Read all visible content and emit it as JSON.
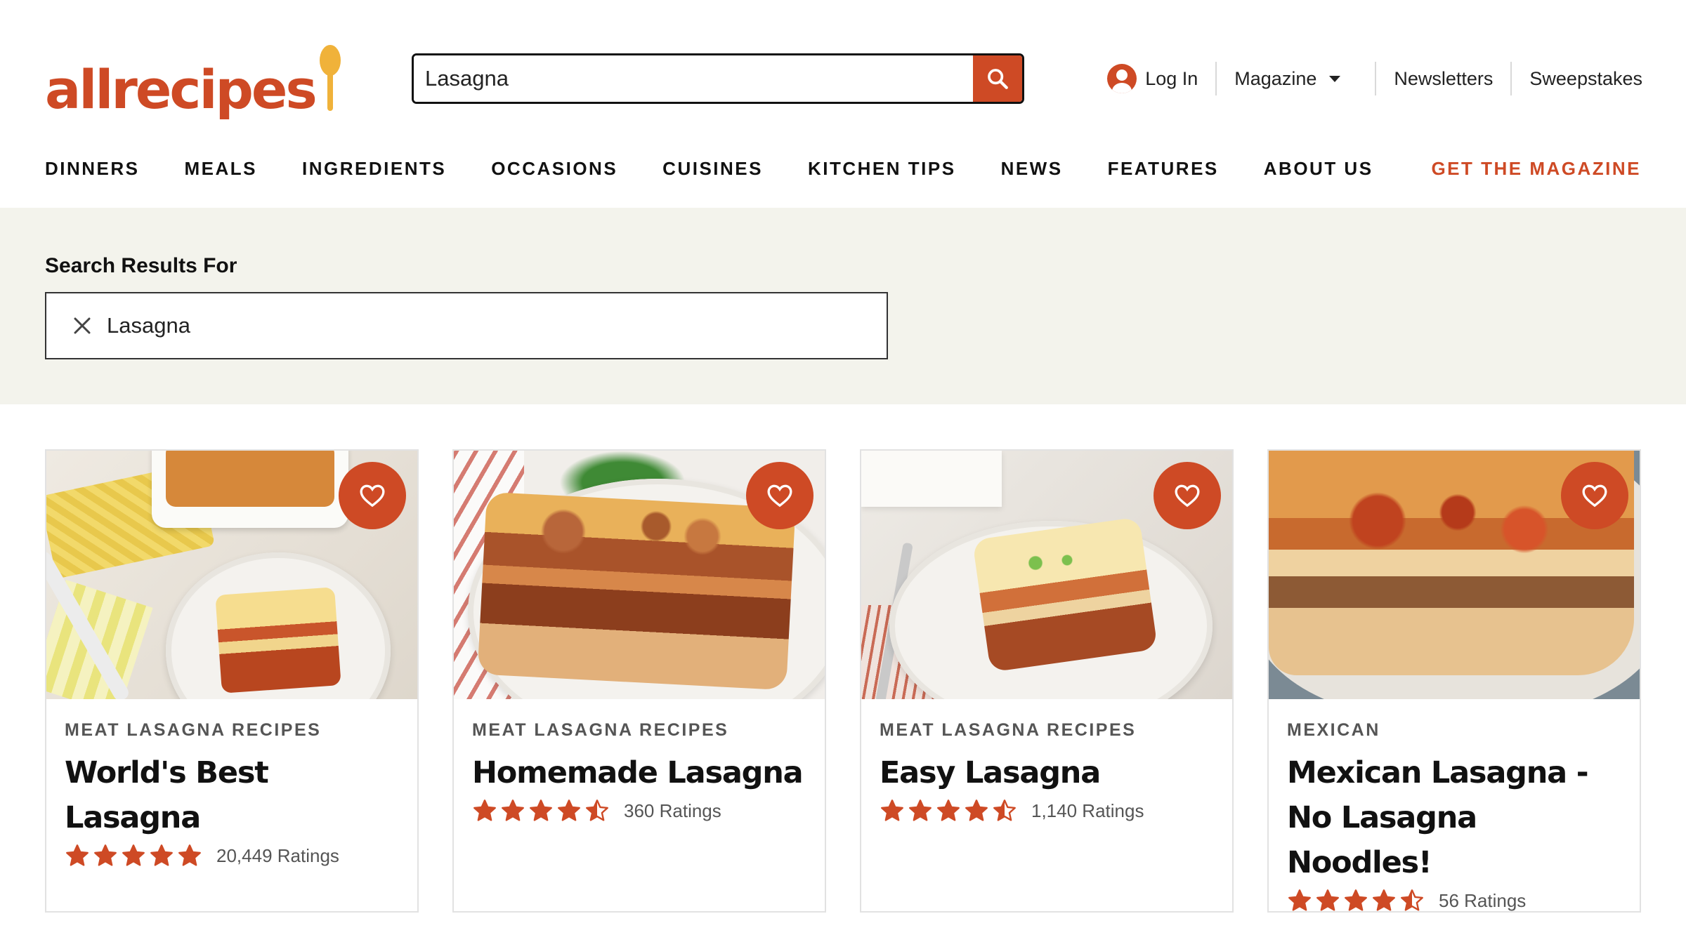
{
  "brand": {
    "name": "allrecipes",
    "accent_color": "#ce4a25",
    "spoon_color": "#f0b23a"
  },
  "search": {
    "value": "Lasagna",
    "button_icon": "search-icon"
  },
  "top_links": {
    "login": "Log In",
    "magazine": "Magazine",
    "newsletters": "Newsletters",
    "sweepstakes": "Sweepstakes"
  },
  "nav": {
    "items": [
      "DINNERS",
      "MEALS",
      "INGREDIENTS",
      "OCCASIONS",
      "CUISINES",
      "KITCHEN TIPS",
      "NEWS",
      "FEATURES",
      "ABOUT US"
    ],
    "cta": "GET THE MAGAZINE"
  },
  "results": {
    "label": "Search Results For",
    "term": "Lasagna"
  },
  "cards": [
    {
      "tag": "MEAT LASAGNA RECIPES",
      "title": "World's Best Lasagna",
      "stars": 5,
      "ratings": "20,449 Ratings"
    },
    {
      "tag": "MEAT LASAGNA RECIPES",
      "title": "Homemade Lasagna",
      "stars": 4.5,
      "ratings": "360 Ratings"
    },
    {
      "tag": "MEAT LASAGNA RECIPES",
      "title": "Easy Lasagna",
      "stars": 4.5,
      "ratings": "1,140 Ratings"
    },
    {
      "tag": "MEXICAN",
      "title": "Mexican Lasagna - No Lasagna Noodles!",
      "stars": 4.5,
      "ratings": "56 Ratings"
    }
  ]
}
